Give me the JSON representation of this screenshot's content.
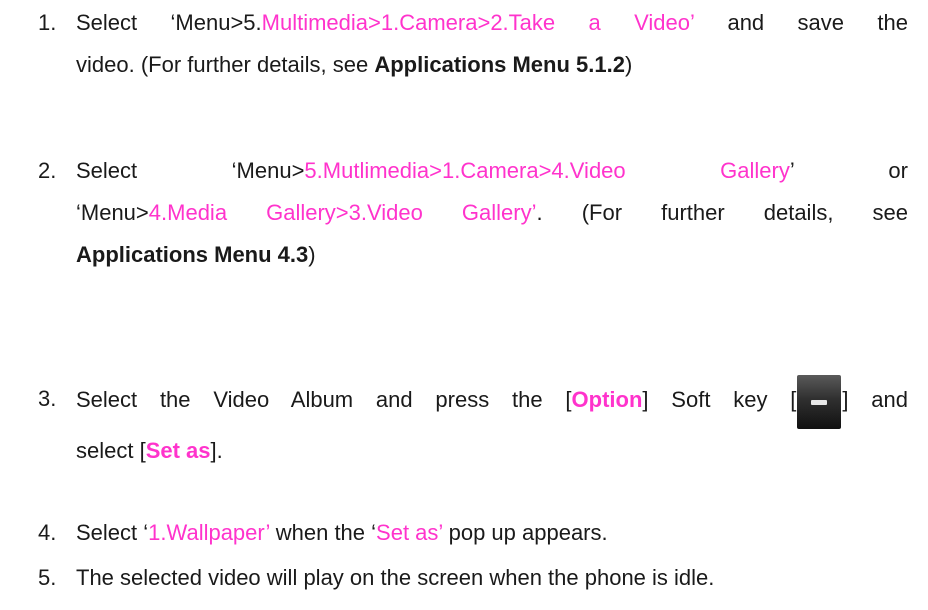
{
  "steps": [
    {
      "number": "1.",
      "lines": [
        [
          "Select ‘Menu>5.",
          "Multimedia>1.Camera>2.Take a Video’",
          " and save the"
        ],
        [
          "video. (For further details, see ",
          "Applications Menu 5.1.2",
          ")"
        ]
      ]
    },
    {
      "number": "2.",
      "lines": [
        [
          "Select ‘Menu>",
          "5.Mutlimedia>1.Camera>4.Video Gallery",
          "’ or"
        ],
        [
          "‘Menu>",
          "4.Media Gallery>3.Video Gallery’",
          ". (For further details, see"
        ],
        [
          "Applications Menu 4.3",
          ")"
        ]
      ]
    },
    {
      "number": "3.",
      "lines": [
        [
          "Select the Video Album and press the [",
          "Option",
          "] Soft key [",
          "] and"
        ],
        [
          "select [",
          "Set as",
          "]."
        ]
      ],
      "icon": "minus-softkey-icon"
    },
    {
      "number": "4.",
      "lines": [
        [
          "Select ‘",
          "1.Wallpaper’",
          " when the ‘",
          "Set as’",
          " pop up appears."
        ]
      ]
    },
    {
      "number": "5.",
      "lines": [
        [
          "The selected video will play on the screen when the phone is idle."
        ]
      ]
    }
  ],
  "colors": {
    "highlight": "#ff33cc",
    "text": "#1a1a1a"
  }
}
